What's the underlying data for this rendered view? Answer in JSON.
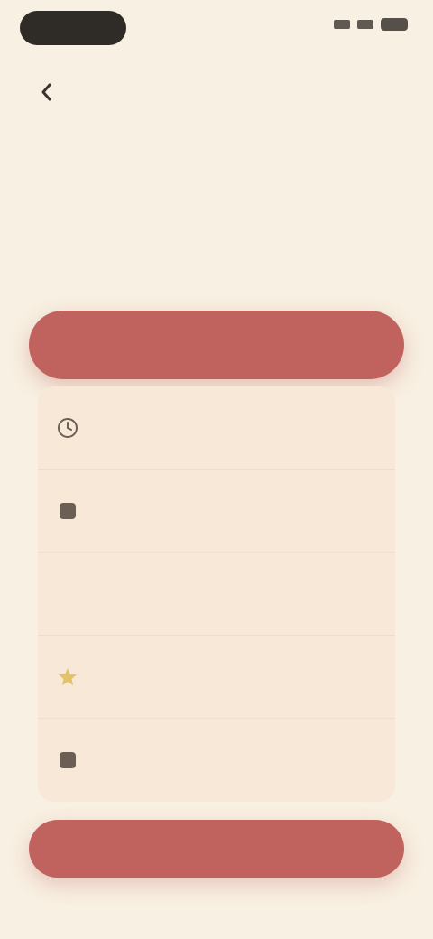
{
  "colors": {
    "background": "#f8f0e2",
    "accent": "#c0635f",
    "list_bg": "#f7e8d8"
  },
  "status_bar": {
    "time": ""
  },
  "header": {
    "back_label": ""
  },
  "page": {
    "title": "",
    "subtitle": ""
  },
  "primary_button": {
    "label": ""
  },
  "options": [
    {
      "label": "",
      "icon": "clock-icon"
    },
    {
      "label": "",
      "icon": "square-icon"
    },
    {
      "label": "",
      "icon": "blank-icon"
    },
    {
      "label": "",
      "icon": "star-icon"
    },
    {
      "label": "",
      "icon": "square-icon"
    }
  ],
  "footer_button": {
    "label": ""
  }
}
